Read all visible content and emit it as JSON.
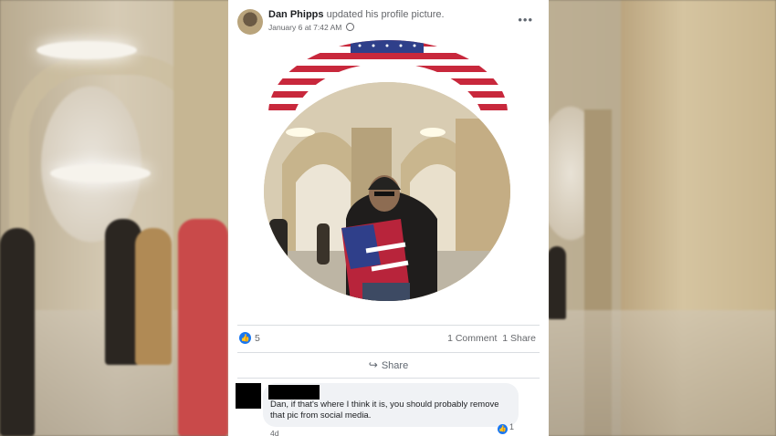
{
  "post": {
    "author": "Dan Phipps",
    "action": "updated his profile picture.",
    "timestamp": "January 6 at 7:42 AM",
    "privacy_icon": "globe-icon",
    "more_icon": "more-options-icon"
  },
  "reactions": {
    "like_count": "5",
    "comments_label": "1 Comment",
    "shares_label": "1 Share"
  },
  "actions": {
    "share_label": "Share"
  },
  "comment": {
    "text": "Dan, if that's where I think it is, you should probably remove that pic from social media.",
    "like_count": "1",
    "age": "4d"
  },
  "colors": {
    "facebook_blue": "#1877f2",
    "card_bg": "#ffffff",
    "comment_bg": "#f0f2f5"
  }
}
